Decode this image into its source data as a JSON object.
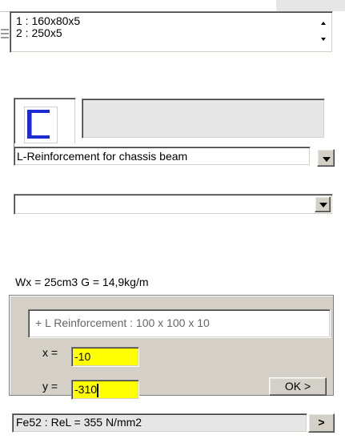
{
  "profiles_list": {
    "items": [
      "1 : 160x80x5",
      "2 : 250x5"
    ]
  },
  "shape_preview": {
    "icon": "c-channel-profile-icon",
    "color": "#1e2bd0"
  },
  "reinforcement_type": {
    "selected": "L-Reinforcement for chassis beam"
  },
  "secondary_select": {
    "selected": ""
  },
  "properties_text": "Wx = 25cm3   G = 14,9kg/m",
  "summary_text": "+ L Reinforcement : 100 x 100 x 10",
  "position": {
    "x_label": "x =",
    "x_value": "-10",
    "y_label": "y =",
    "y_value": "-310"
  },
  "ok_label": "OK >",
  "material_status": "Fe52 : ReL = 355 N/mm2",
  "go_label": ">",
  "colors": {
    "highlight_input": "#ffff00",
    "dialog_gray": "#d4d0c8"
  }
}
